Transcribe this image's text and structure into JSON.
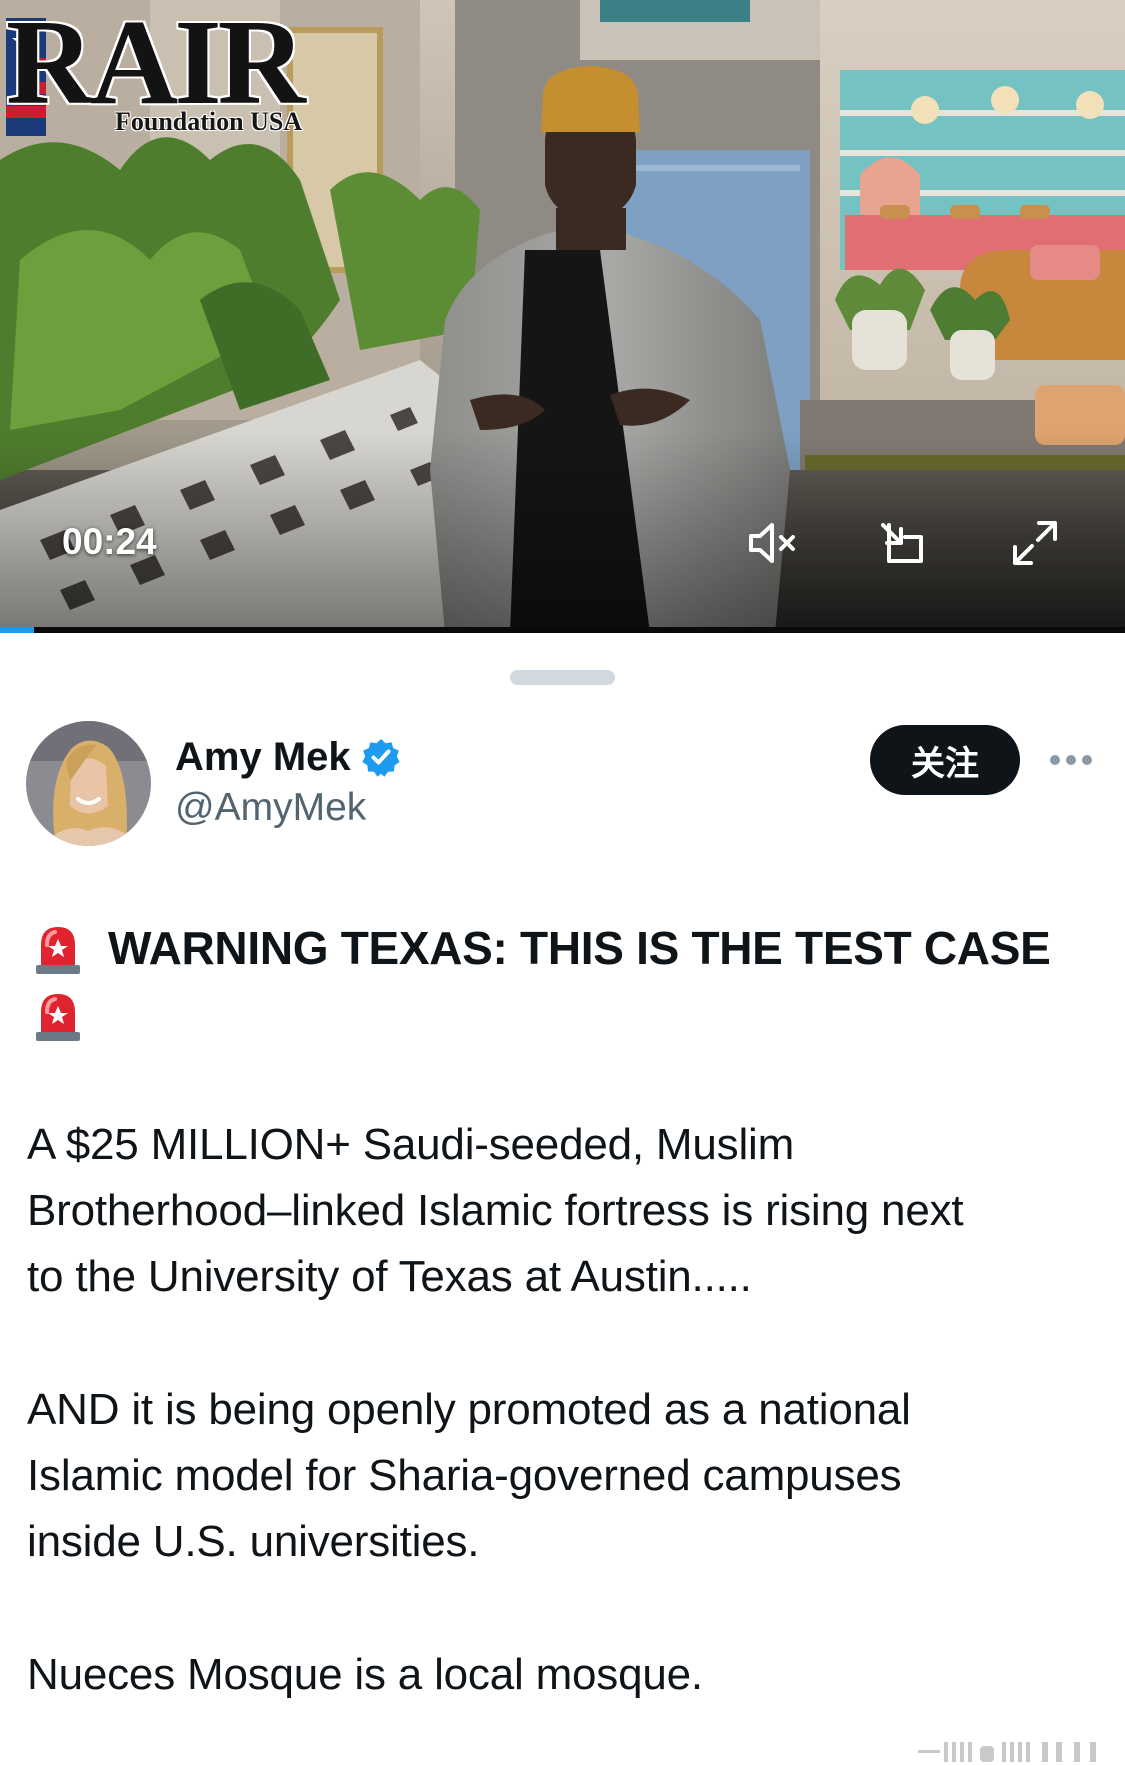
{
  "video": {
    "watermark_main": "RAIR",
    "watermark_sub": "Foundation USA",
    "elapsed": "00:24",
    "progress_fraction": 0.03,
    "controls": [
      "mute-icon",
      "picture-in-picture-icon",
      "fullscreen-icon"
    ]
  },
  "author": {
    "name": "Amy Mek",
    "handle": "@AmyMek",
    "verified": true,
    "follow_label": "关注",
    "more_icon": "ellipsis-icon"
  },
  "post": {
    "headline": "WARNING TEXAS: THIS IS THE TEST CASE",
    "headline_icon": "police-siren-emoji",
    "paragraph_1": [
      "A $25 MILLION+ Saudi-seeded, Muslim",
      "Brotherhood–linked Islamic fortress is rising next",
      "to the University of Texas at Austin....."
    ],
    "paragraph_2": [
      "AND it is being openly promoted as a national",
      "Islamic model for Sharia-governed campuses",
      "inside U.S. universities."
    ],
    "paragraph_3": [
      "Nueces Mosque is a local mosque."
    ]
  },
  "colors": {
    "accent": "#1d9bf0",
    "text": "#0f1419",
    "secondary_text": "#536471",
    "follow_button_bg": "#0f1419"
  }
}
